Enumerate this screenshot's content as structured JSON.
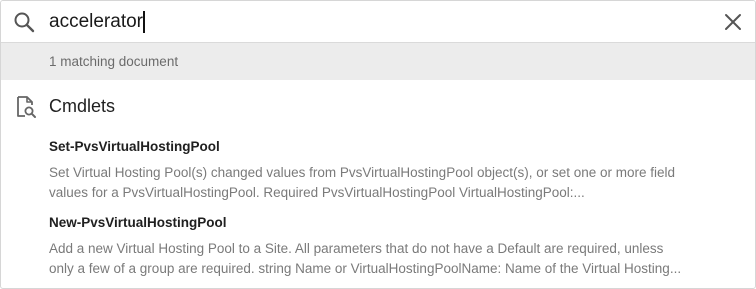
{
  "search": {
    "value": "accelerator",
    "icon": "search-icon",
    "clear_icon": "close-icon"
  },
  "match_count_text": "1 matching document",
  "section": {
    "icon": "document-search-icon",
    "title": "Cmdlets"
  },
  "results": [
    {
      "title": "Set-PvsVirtualHostingPool",
      "desc_line1": "Set Virtual Hosting Pool(s) changed values from PvsVirtualHostingPool object(s), or set one or more field",
      "desc_line2": "values for a PvsVirtualHostingPool. Required PvsVirtualHostingPool VirtualHostingPool:..."
    },
    {
      "title": "New-PvsVirtualHostingPool",
      "desc_line1": "Add a new Virtual Hosting Pool to a Site. All parameters that do not have a Default are required, unless",
      "desc_line2": "only a few of a group are required. string Name or VirtualHostingPoolName: Name of the Virtual Hosting..."
    }
  ],
  "colors": {
    "background": "#ffffff",
    "strip": "#ececec",
    "muted_text": "#7a7a7a",
    "title_text": "#202020"
  }
}
